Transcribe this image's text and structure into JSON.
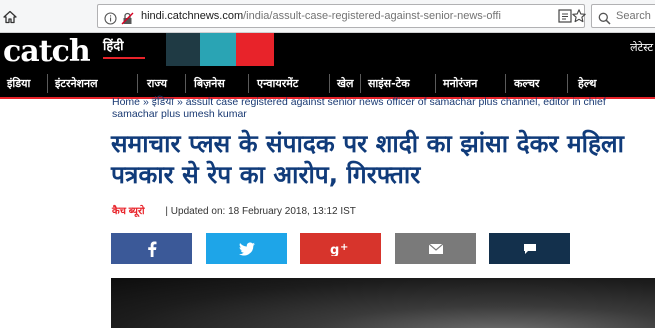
{
  "browser": {
    "url_host": "hindi.catchnews.com",
    "url_path": "/india/assult-case-registered-against-senior-news-offi",
    "search_placeholder": "Search"
  },
  "site": {
    "logo_text": "catch",
    "logo_hindi": "हिंदी",
    "latest_link": "लेटेस्ट",
    "accent": "#e8232a",
    "header_blocks": [
      "#1f3a44",
      "#2aa4b4",
      "#e8232a"
    ]
  },
  "nav": {
    "items": [
      "इंडिया",
      "इंटरनेशनल",
      "राज्य",
      "बिज़नेस",
      "एन्वायरमेंट",
      "खेल",
      "साइंस-टेक",
      "मनोरंजन",
      "कल्चर",
      "हेल्थ"
    ]
  },
  "breadcrumb": {
    "home": "Home",
    "section": "इंडिया",
    "current": "assult case registered against senior news officer of samachar plus channel, editor in chief samachar plus umesh kumar"
  },
  "article": {
    "headline": "समाचार प्लस के संपादक पर शादी का झांसा देकर महिला पत्रकार से रेप का आरोप, गिरफ्तार",
    "author": "कैच ब्यूरो",
    "updated": "| Updated on: 18 February 2018, 13:12 IST"
  },
  "share": [
    {
      "name": "facebook",
      "icon": "facebook-icon",
      "color": "#3b5998"
    },
    {
      "name": "twitter",
      "icon": "twitter-icon",
      "color": "#1ea5e8"
    },
    {
      "name": "google-plus",
      "icon": "google-plus-icon",
      "color": "#d7342c"
    },
    {
      "name": "email",
      "icon": "email-icon",
      "color": "#7a7a7a"
    },
    {
      "name": "comment",
      "icon": "comment-icon",
      "color": "#13304c"
    }
  ]
}
